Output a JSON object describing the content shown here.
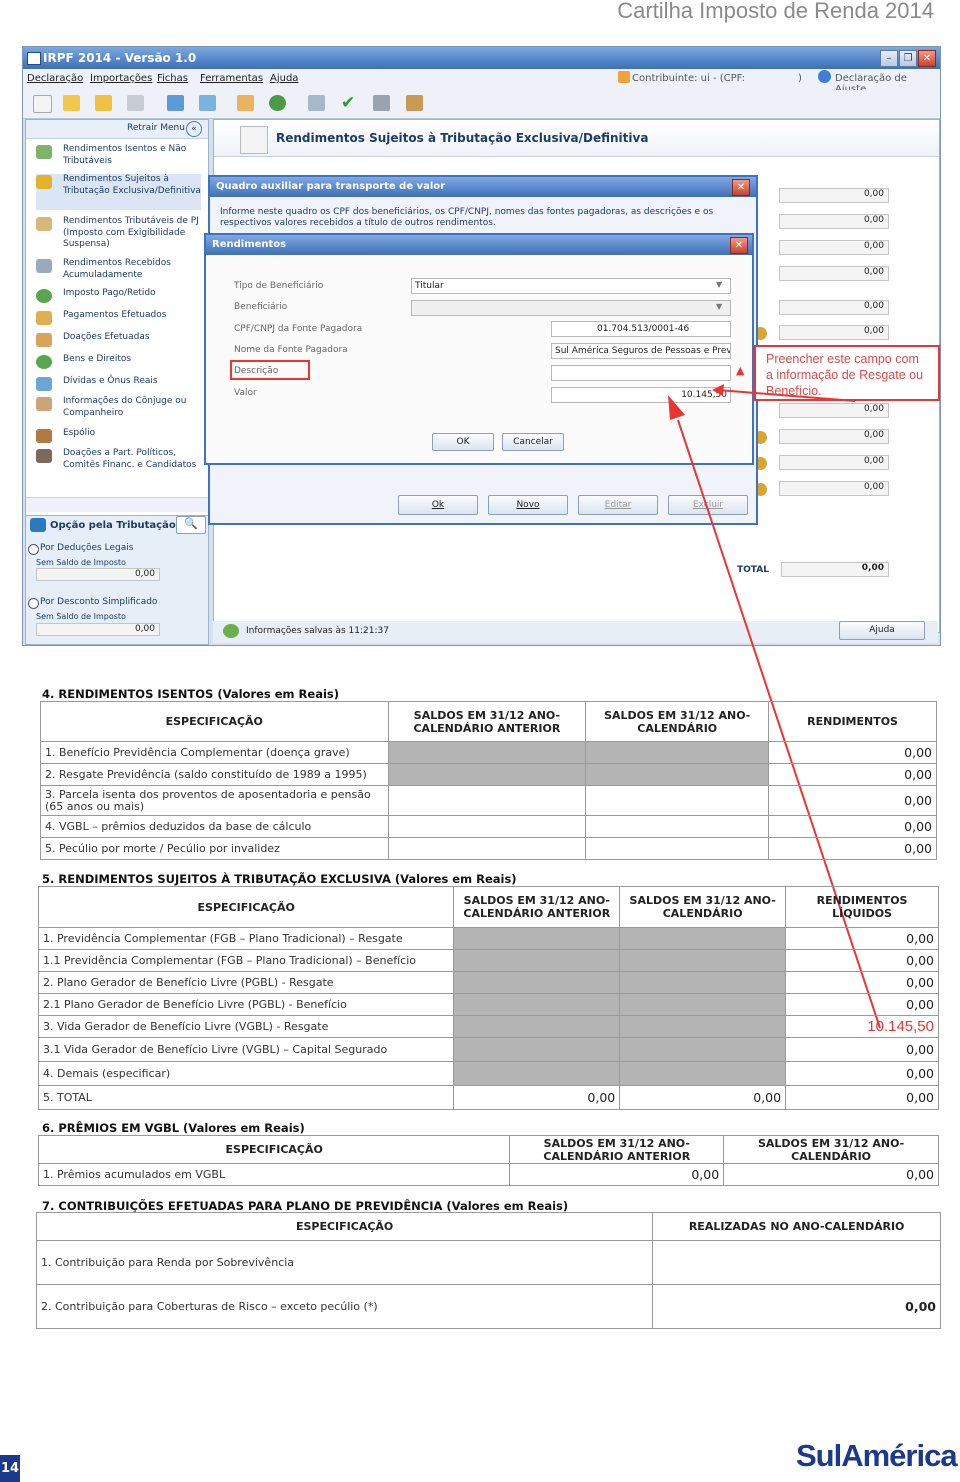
{
  "page": {
    "header_title": "Cartilha  Imposto de Renda 2014",
    "page_number": "14",
    "brand": "SulAmérica"
  },
  "app": {
    "title": "IRPF 2014 - Versão 1.0",
    "menu": [
      "Declaração",
      "Importações",
      "Fichas",
      "Ferramentas",
      "Ajuda"
    ],
    "contribuinte": "Contribuinte: ui - (CPF:",
    "contribuinte_end": ")",
    "declaracao_tipo": "Declaração de Ajuste",
    "retrair": "Retrair Menu",
    "sidebar": [
      "Rendimentos Isentos e Não Tributáveis",
      "Rendimentos Sujeitos à Tributação Exclusiva/Definitiva",
      "Rendimentos Tributáveis de PJ (Imposto com Exigibilidade Suspensa)",
      "Rendimentos Recebidos Acumuladamente",
      "Imposto Pago/Retido",
      "Pagamentos Efetuados",
      "Doações Efetuadas",
      "Bens e Direitos",
      "Dívidas e Ônus Reais",
      "Informações do Cônjuge ou Companheiro",
      "Espólio",
      "Doações a Part. Políticos, Comitês Financ. e Candidatos"
    ],
    "opcao_title": "Opção pela Tributação:",
    "opcao_legais": "Por Deduções Legais",
    "opcao_legais_sub": "Sem Saldo de Imposto",
    "opcao_legais_val": "0,00",
    "opcao_simpl": "Por Desconto Simplificado",
    "opcao_simpl_sub": "Sem Saldo de Imposto",
    "opcao_simpl_val": "0,00",
    "main_title": "Rendimentos Sujeitos à Tributação Exclusiva/Definitiva",
    "right_values": [
      "0,00",
      "0,00",
      "0,00",
      "0,00",
      "0,00",
      "0,00",
      "0,00",
      "0,00",
      "0,00",
      "0,00"
    ],
    "total_label": "TOTAL",
    "total_value": "0,00",
    "status": "Informações salvas às 11:21:37",
    "ajuda_btn": "Ajuda",
    "bottom_buttons": [
      "Ok",
      "Novo",
      "Editar",
      "Excluir"
    ]
  },
  "dialog_quadro": {
    "title": "Quadro auxiliar para transporte de valor",
    "info": "Informe neste quadro os CPF dos beneficiários, os CPF/CNPJ, nomes das fontes pagadoras, as descrições e os respectivos valores recebidos a título de outros rendimentos."
  },
  "dialog_rend": {
    "title": "Rendimentos",
    "labels": [
      "Tipo de Beneficiário",
      "Beneficiário",
      "CPF/CNPJ da Fonte Pagadora",
      "Nome da Fonte Pagadora",
      "Descrição",
      "Valor"
    ],
    "tipo_value": "Titular",
    "cnpj_value": "01.704.513/0001-46",
    "nome_value": "Sul América Seguros de Pessoas e Prev",
    "valor_value": "10.145,50",
    "ok": "OK",
    "cancelar": "Cancelar"
  },
  "callout": "Preencher este campo com a informação de Resgate ou Benefício.",
  "table4": {
    "title": "4.  RENDIMENTOS ISENTOS (Valores em Reais)",
    "headers": [
      "ESPECIFICAÇÃO",
      "SALDOS EM 31/12 ANO-CALENDÁRIO ANTERIOR",
      "SALDOS EM 31/12 ANO-CALENDÁRIO",
      "RENDIMENTOS"
    ],
    "rows": [
      {
        "spec": "1. Benefício Previdência Complementar (doença grave)",
        "value": "0,00"
      },
      {
        "spec": "2. Resgate Previdência (saldo constituído de 1989 a 1995)",
        "value": "0,00"
      },
      {
        "spec": "3. Parcela isenta dos proventos de aposentadoria e pensão (65 anos ou mais)",
        "value": "0,00"
      },
      {
        "spec": "4. VGBL – prêmios deduzidos da base de cálculo",
        "value": "0,00"
      },
      {
        "spec": "5. Pecúlio por morte / Pecúlio por invalidez",
        "value": "0,00"
      }
    ]
  },
  "table5": {
    "title": "5.  RENDIMENTOS SUJEITOS À TRIBUTAÇÃO EXCLUSIVA  (Valores em Reais)",
    "headers": [
      "ESPECIFICAÇÃO",
      "SALDOS EM 31/12 ANO-CALENDÁRIO ANTERIOR",
      "SALDOS EM 31/12 ANO-CALENDÁRIO",
      "RENDIMENTOS LÍQUIDOS"
    ],
    "rows": [
      {
        "spec": "1. Previdência Complementar (FGB – Plano Tradicional) – Resgate",
        "value": "0,00"
      },
      {
        "spec": "1.1 Previdência Complementar (FGB – Plano Tradicional) – Benefício",
        "value": "0,00"
      },
      {
        "spec": "2.  Plano Gerador de Benefício Livre (PGBL) - Resgate",
        "value": "0,00"
      },
      {
        "spec": "2.1 Plano Gerador de Benefício Livre (PGBL) - Benefício",
        "value": "0,00"
      },
      {
        "spec": "3.  Vida Gerador de Benefício Livre (VGBL) - Resgate",
        "value": "10.145,50"
      },
      {
        "spec": "3.1 Vida Gerador de Benefício Livre (VGBL) – Capital Segurado",
        "value": "0,00"
      },
      {
        "spec": "4. Demais (especificar)",
        "value": "0,00"
      }
    ],
    "total": {
      "spec": "5. TOTAL",
      "v1": "0,00",
      "v2": "0,00",
      "v3": "0,00"
    }
  },
  "table6": {
    "title": "6.  PRÊMIOS EM VGBL (Valores em Reais)",
    "headers": [
      "ESPECIFICAÇÃO",
      "SALDOS EM 31/12 ANO-CALENDÁRIO ANTERIOR",
      "SALDOS EM 31/12 ANO-CALENDÁRIO"
    ],
    "row": {
      "spec": "1. Prêmios acumulados em VGBL",
      "v1": "0,00",
      "v2": "0,00"
    }
  },
  "table7": {
    "title": "7. CONTRIBUIÇÕES EFETUADAS PARA PLANO DE PREVIDÊNCIA (Valores em Reais)",
    "headers": [
      "ESPECIFICAÇÃO",
      "REALIZADAS NO ANO-CALENDÁRIO"
    ],
    "rows": [
      {
        "spec": "1. Contribuição para Renda por Sobrevivência",
        "value": ""
      },
      {
        "spec": "2. Contribuição para Coberturas de Risco – exceto pecúlio (*)",
        "value": "0,00"
      }
    ]
  },
  "colors": {
    "accent_red": "#e33333",
    "brand_blue": "#1c3a8c",
    "window_blue": "#3d6fb8"
  }
}
